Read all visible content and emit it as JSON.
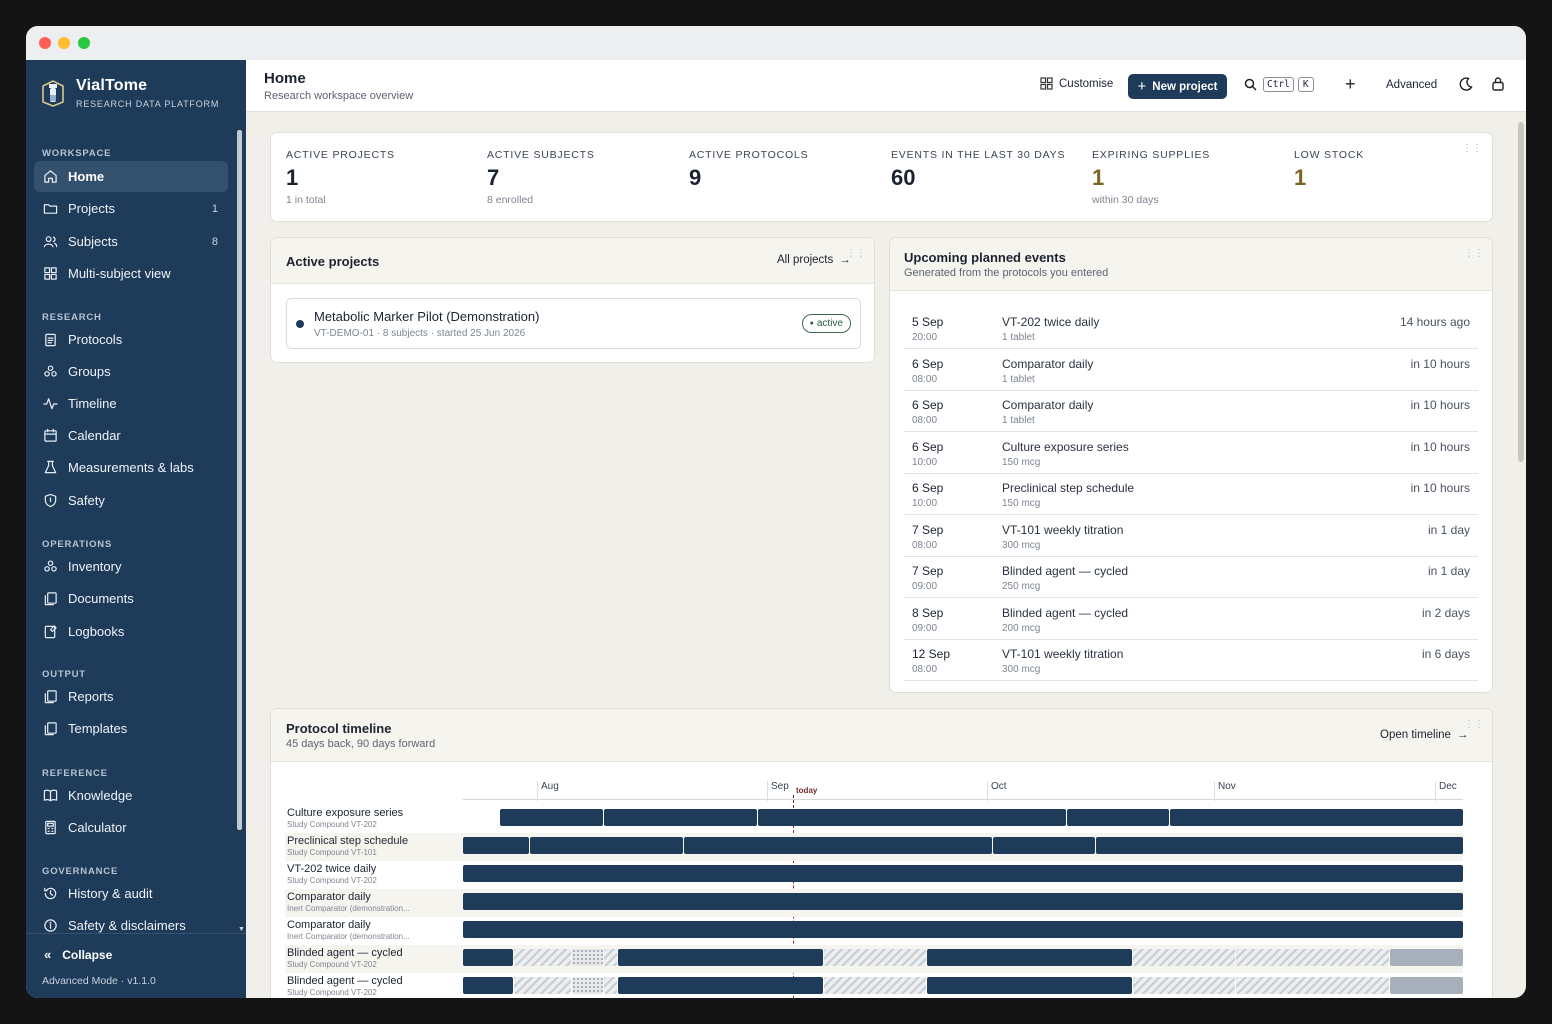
{
  "brand": {
    "name": "VialTome",
    "subtitle": "RESEARCH DATA PLATFORM"
  },
  "sidebar": {
    "sections": [
      {
        "title": "WORKSPACE",
        "items": [
          {
            "label": "Home",
            "icon": "home-icon",
            "active": true,
            "count": ""
          },
          {
            "label": "Projects",
            "icon": "folder-icon",
            "count": "1"
          },
          {
            "label": "Subjects",
            "icon": "users-icon",
            "count": "8"
          },
          {
            "label": "Multi-subject view",
            "icon": "grid-icon",
            "count": ""
          }
        ]
      },
      {
        "title": "RESEARCH",
        "items": [
          {
            "label": "Protocols",
            "icon": "clipboard-icon"
          },
          {
            "label": "Groups",
            "icon": "groups-icon"
          },
          {
            "label": "Timeline",
            "icon": "pulse-icon"
          },
          {
            "label": "Calendar",
            "icon": "calendar-icon"
          },
          {
            "label": "Measurements & labs",
            "icon": "flask-icon"
          },
          {
            "label": "Safety",
            "icon": "shield-icon"
          }
        ]
      },
      {
        "title": "OPERATIONS",
        "items": [
          {
            "label": "Inventory",
            "icon": "boxes-icon"
          },
          {
            "label": "Documents",
            "icon": "documents-icon"
          },
          {
            "label": "Logbooks",
            "icon": "logbook-icon"
          }
        ]
      },
      {
        "title": "OUTPUT",
        "items": [
          {
            "label": "Reports",
            "icon": "reports-icon"
          },
          {
            "label": "Templates",
            "icon": "templates-icon"
          }
        ]
      },
      {
        "title": "REFERENCE",
        "items": [
          {
            "label": "Knowledge",
            "icon": "book-icon"
          },
          {
            "label": "Calculator",
            "icon": "calculator-icon"
          }
        ]
      },
      {
        "title": "GOVERNANCE",
        "items": [
          {
            "label": "History & audit",
            "icon": "history-icon"
          },
          {
            "label": "Safety & disclaimers",
            "icon": "info-icon"
          }
        ]
      }
    ],
    "collapse_label": "Collapse",
    "footer": "Advanced Mode · v1.1.0"
  },
  "header": {
    "title": "Home",
    "subtitle": "Research workspace overview",
    "customise": "Customise",
    "new_project": "New project",
    "kbd1": "Ctrl",
    "kbd2": "K",
    "advanced": "Advanced"
  },
  "stats": [
    {
      "label": "ACTIVE PROJECTS",
      "value": "1",
      "sub": "1 in total"
    },
    {
      "label": "ACTIVE SUBJECTS",
      "value": "7",
      "sub": "8 enrolled"
    },
    {
      "label": "ACTIVE PROTOCOLS",
      "value": "9",
      "sub": ""
    },
    {
      "label": "EVENTS IN THE LAST 30 DAYS",
      "value": "60",
      "sub": ""
    },
    {
      "label": "EXPIRING SUPPLIES",
      "value": "1",
      "sub": "within 30 days"
    },
    {
      "label": "LOW STOCK",
      "value": "1",
      "sub": ""
    }
  ],
  "active_projects": {
    "title": "Active projects",
    "link": "All projects",
    "project": {
      "name": "Metabolic Marker Pilot (Demonstration)",
      "meta": "VT-DEMO-01 · 8 subjects · started 25 Jun 2026",
      "status": "active"
    }
  },
  "upcoming": {
    "title": "Upcoming planned events",
    "subtitle": "Generated from the protocols you entered",
    "events": [
      {
        "date": "5 Sep",
        "time": "20:00",
        "name": "VT-202 twice daily",
        "dose": "1 tablet",
        "when": "14 hours ago"
      },
      {
        "date": "6 Sep",
        "time": "08:00",
        "name": "Comparator daily",
        "dose": "1 tablet",
        "when": "in 10 hours"
      },
      {
        "date": "6 Sep",
        "time": "08:00",
        "name": "Comparator daily",
        "dose": "1 tablet",
        "when": "in 10 hours"
      },
      {
        "date": "6 Sep",
        "time": "10:00",
        "name": "Culture exposure series",
        "dose": "150 mcg",
        "when": "in 10 hours"
      },
      {
        "date": "6 Sep",
        "time": "10:00",
        "name": "Preclinical step schedule",
        "dose": "150 mcg",
        "when": "in 10 hours"
      },
      {
        "date": "7 Sep",
        "time": "08:00",
        "name": "VT-101 weekly titration",
        "dose": "300 mcg",
        "when": "in 1 day"
      },
      {
        "date": "7 Sep",
        "time": "09:00",
        "name": "Blinded agent — cycled",
        "dose": "250 mcg",
        "when": "in 1 day"
      },
      {
        "date": "8 Sep",
        "time": "09:00",
        "name": "Blinded agent — cycled",
        "dose": "200 mcg",
        "when": "in 2 days"
      },
      {
        "date": "12 Sep",
        "time": "08:00",
        "name": "VT-101 weekly titration",
        "dose": "300 mcg",
        "when": "in 6 days"
      }
    ]
  },
  "timeline": {
    "title": "Protocol timeline",
    "subtitle": "45 days back, 90 days forward",
    "link": "Open timeline",
    "months": [
      "Aug",
      "Sep",
      "Oct",
      "Nov",
      "Dec"
    ],
    "today_label": "today",
    "rows": [
      {
        "name": "Culture exposure series",
        "sub": "Study Compound VT-202"
      },
      {
        "name": "Preclinical step schedule",
        "sub": "Study Compound VT-101"
      },
      {
        "name": "VT-202 twice daily",
        "sub": "Study Compound VT-202"
      },
      {
        "name": "Comparator daily",
        "sub": "Inert Comparator (demonstration..."
      },
      {
        "name": "Comparator daily",
        "sub": "Inert Comparator (demonstration..."
      },
      {
        "name": "Blinded agent — cycled",
        "sub": "Study Compound VT-202"
      },
      {
        "name": "Blinded agent — cycled",
        "sub": "Study Compound VT-202"
      }
    ]
  }
}
